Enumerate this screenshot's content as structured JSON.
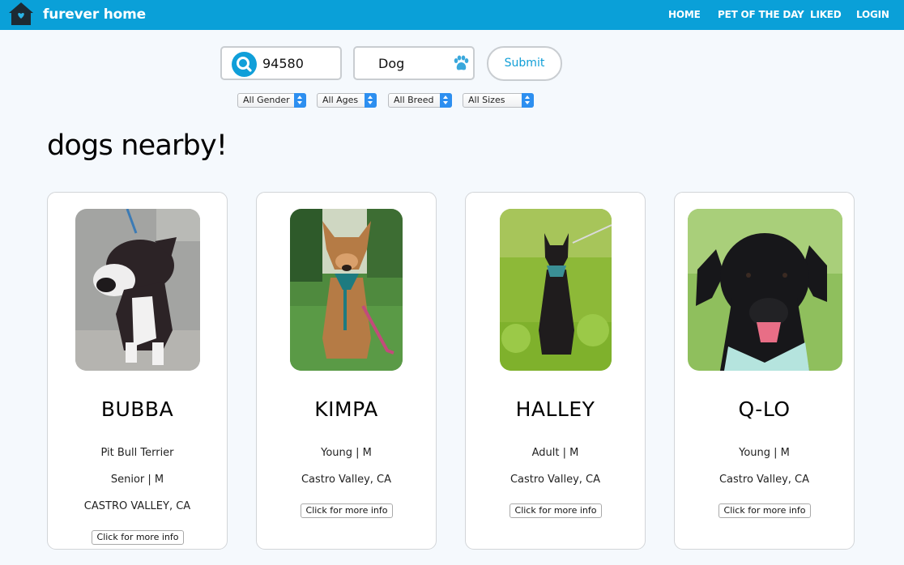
{
  "header": {
    "brand": "furever home",
    "nav": [
      "HOME",
      "PET OF THE DAY",
      "LIKED",
      "LOGIN"
    ]
  },
  "search": {
    "zip_value": "94580",
    "pet_type_value": "Dog",
    "submit_label": "Submit"
  },
  "filters": [
    "All Gender",
    "All Ages",
    "All Breed",
    "All Sizes"
  ],
  "main": {
    "heading": "dogs nearby!"
  },
  "pets": [
    {
      "name": "BUBBA",
      "info": [
        "Pit Bull Terrier",
        "Senior | M",
        "CASTRO VALLEY, CA"
      ],
      "button": "Click for more info"
    },
    {
      "name": "KIMPA",
      "info": [
        "Young | M",
        "Castro Valley, CA"
      ],
      "button": "Click for more info"
    },
    {
      "name": "HALLEY",
      "info": [
        "Adult | M",
        "Castro Valley, CA"
      ],
      "button": "Click for more info"
    },
    {
      "name": "Q-LO",
      "info": [
        "Young | M",
        "Castro Valley, CA"
      ],
      "button": "Click for more info"
    }
  ],
  "icons": [
    "house-heart-icon",
    "search-icon",
    "paw-icon"
  ],
  "colors": {
    "brand": "#0aa0d8",
    "accent": "#119fd7",
    "background": "#f5f9fd"
  }
}
